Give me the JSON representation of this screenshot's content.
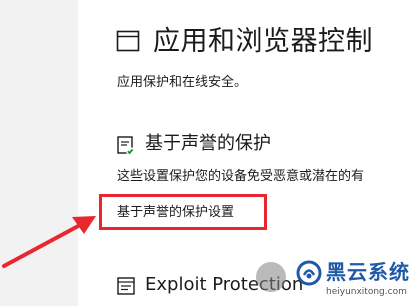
{
  "page": {
    "title": "应用和浏览器控制",
    "subtitle": "应用保护和在线安全。",
    "icon": "browser-window-icon"
  },
  "reputation_section": {
    "title": "基于声誉的保护",
    "icon": "reputation-shield-icon",
    "description": "这些设置保护您的设备免受恶意或潜在的有",
    "settings_link": "基于声誉的保护设置"
  },
  "exploit_section": {
    "title": "Exploit Protection",
    "icon": "exploit-protection-icon"
  },
  "annotation": {
    "highlight_color": "#e8272f",
    "arrow_color": "#e8272f"
  },
  "watermark": {
    "name": "黑云系统",
    "url": "heiyunxitong.com",
    "color": "#1f5aa8"
  }
}
